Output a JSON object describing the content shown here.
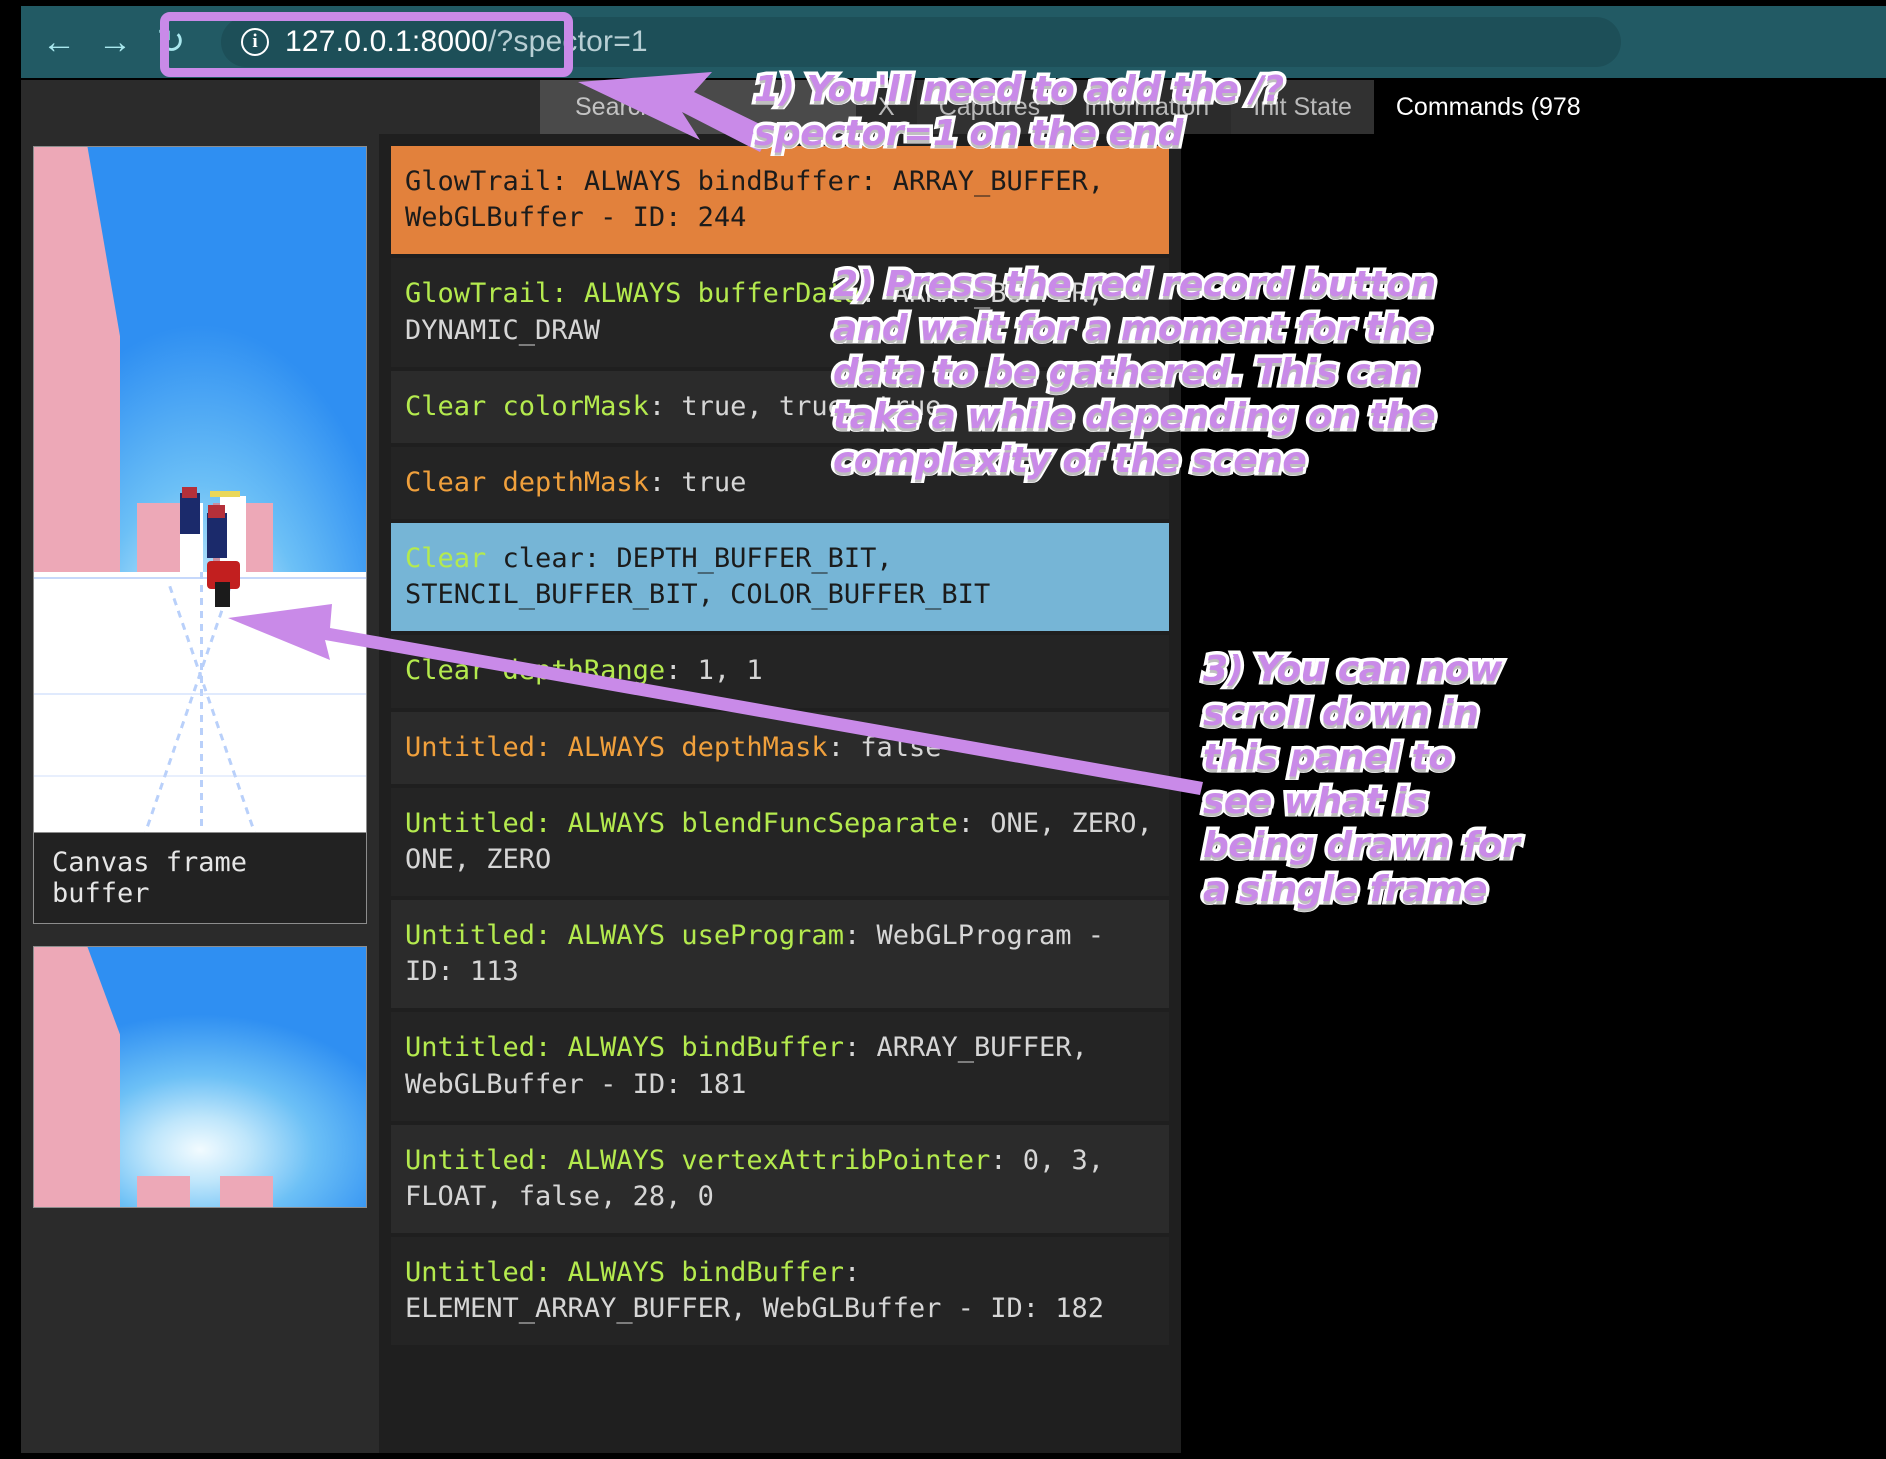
{
  "browser": {
    "back_icon": "arrow-left-icon",
    "forward_icon": "arrow-right-icon",
    "reload_icon": "reload-icon",
    "info_icon": "info-circle-icon",
    "url_main": "127.0.0.1:8000",
    "url_suffix": "/?spector=1",
    "url_full": "127.0.0.1:8000/?spector=1"
  },
  "app": {
    "search": {
      "placeholder": "Search..."
    },
    "tabs": [
      {
        "label": "X",
        "active": false
      },
      {
        "label": "Captures",
        "active": false
      },
      {
        "label": "Information",
        "active": false
      },
      {
        "label": "Init State",
        "active": false
      },
      {
        "label": "Commands (978",
        "active": true
      }
    ]
  },
  "thumbnails": [
    {
      "label": "Canvas frame buffer"
    },
    {
      "label": ""
    }
  ],
  "commands": [
    {
      "context": "GlowTrail:",
      "marker": "ALWAYS",
      "func": "bindBuffer",
      "args": "ARRAY_BUFFER, WebGLBuffer - ID: 244",
      "style": "orange"
    },
    {
      "context": "GlowTrail:",
      "marker": "ALWAYS",
      "func": "bufferData",
      "args": "ARRAY_BUFFER, DYNAMIC_DRAW",
      "style": "dark"
    },
    {
      "context": "Clear",
      "marker": "",
      "func": "colorMask",
      "args": "true, true, true",
      "style": "darker"
    },
    {
      "context": "Clear",
      "marker": "",
      "func": "depthMask",
      "args": "true",
      "style": "amber"
    },
    {
      "context": "Clear",
      "marker": "",
      "func": "clear",
      "args": "DEPTH_BUFFER_BIT, STENCIL_BUFFER_BIT, COLOR_BUFFER_BIT",
      "style": "selected"
    },
    {
      "context": "Clear",
      "marker": "",
      "func": "depthRange",
      "args": "1, 1",
      "style": "dark"
    },
    {
      "context": "Untitled:",
      "marker": "ALWAYS",
      "func": "depthMask",
      "args": "false",
      "style": "amber"
    },
    {
      "context": "Untitled:",
      "marker": "ALWAYS",
      "func": "blendFuncSeparate",
      "args": "ONE, ZERO, ONE, ZERO",
      "style": "dark"
    },
    {
      "context": "Untitled:",
      "marker": "ALWAYS",
      "func": "useProgram",
      "args": "WebGLProgram - ID: 113",
      "style": "darker"
    },
    {
      "context": "Untitled:",
      "marker": "ALWAYS",
      "func": "bindBuffer",
      "args": "ARRAY_BUFFER, WebGLBuffer - ID: 181",
      "style": "dark"
    },
    {
      "context": "Untitled:",
      "marker": "ALWAYS",
      "func": "vertexAttribPointer",
      "args": "0, 3, FLOAT, false, 28, 0",
      "style": "darker"
    },
    {
      "context": "Untitled:",
      "marker": "ALWAYS",
      "func": "bindBuffer",
      "args": "ELEMENT_ARRAY_BUFFER, WebGLBuffer - ID: 182",
      "style": "dark"
    }
  ],
  "annotations": [
    {
      "id": "step-1",
      "text": "1) You'll need to add the /?spector=1 on the end"
    },
    {
      "id": "step-2",
      "text": "2) Press the red record button and wait for a moment for the data to be gathered. This can take a while depending on the complexity of the scene"
    },
    {
      "id": "step-3",
      "text": "3) You can now scroll down in this panel to see what is being drawn for a single frame"
    }
  ],
  "colors": {
    "annotation_fill": "#c98ae8",
    "annotation_stroke": "#ffffff",
    "row_highlight_orange": "#e2813c",
    "row_selected_blue": "#76b5d6",
    "cmd_green": "#b4ea4e",
    "cmd_amber": "#f0a03c",
    "browser_bar": "#225a64"
  }
}
